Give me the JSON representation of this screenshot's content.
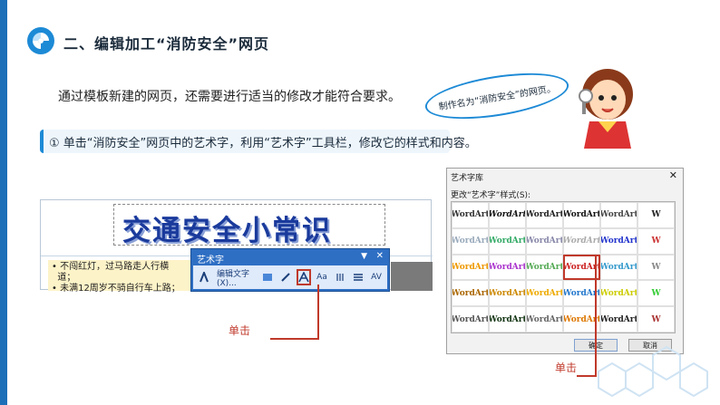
{
  "header": {
    "title": "二、编辑加工“消防安全”网页"
  },
  "intro": "通过模板新建的网页，还需要进行适当的修改才能符合要求。",
  "step": "① 单击“消防安全”网页中的艺术字，利用“艺术字”工具栏，修改它的样式和内容。",
  "bubble": "制作名为“消防安全”的网页。",
  "screenshot": {
    "wordart": "交通安全小常识",
    "bullets": [
      "不闯红灯，过马路走人行横",
      "道；",
      "未满12周岁不骑自行车上路；"
    ]
  },
  "toolbar": {
    "title": "艺术字",
    "edit_text": "编辑文字(X)..."
  },
  "callouts": {
    "click1": "单击",
    "click2": "单击"
  },
  "dialog": {
    "title": "艺术字库",
    "label": "更改“艺术字”样式(S):",
    "ok": "确定",
    "cancel": "取消",
    "cells": [
      "WordArt",
      "WordArt",
      "WordArt",
      "WordArt",
      "WordArt",
      "W",
      "WordArt",
      "WordArt",
      "WordArt",
      "WordArt",
      "WordArt",
      "W",
      "WordArt",
      "WordArt",
      "WordArt",
      "WordArt",
      "WordArt",
      "W",
      "WordArt",
      "WordArt",
      "WordArt",
      "WordArt",
      "WordArt",
      "W",
      "WordArt",
      "WordArt",
      "WordArt",
      "WordArt",
      "WordArt",
      "W"
    ]
  },
  "colors": {
    "accent": "#1d8ad6",
    "highlight": "#c0392b",
    "wordart_blue": "#1a3a9c"
  }
}
